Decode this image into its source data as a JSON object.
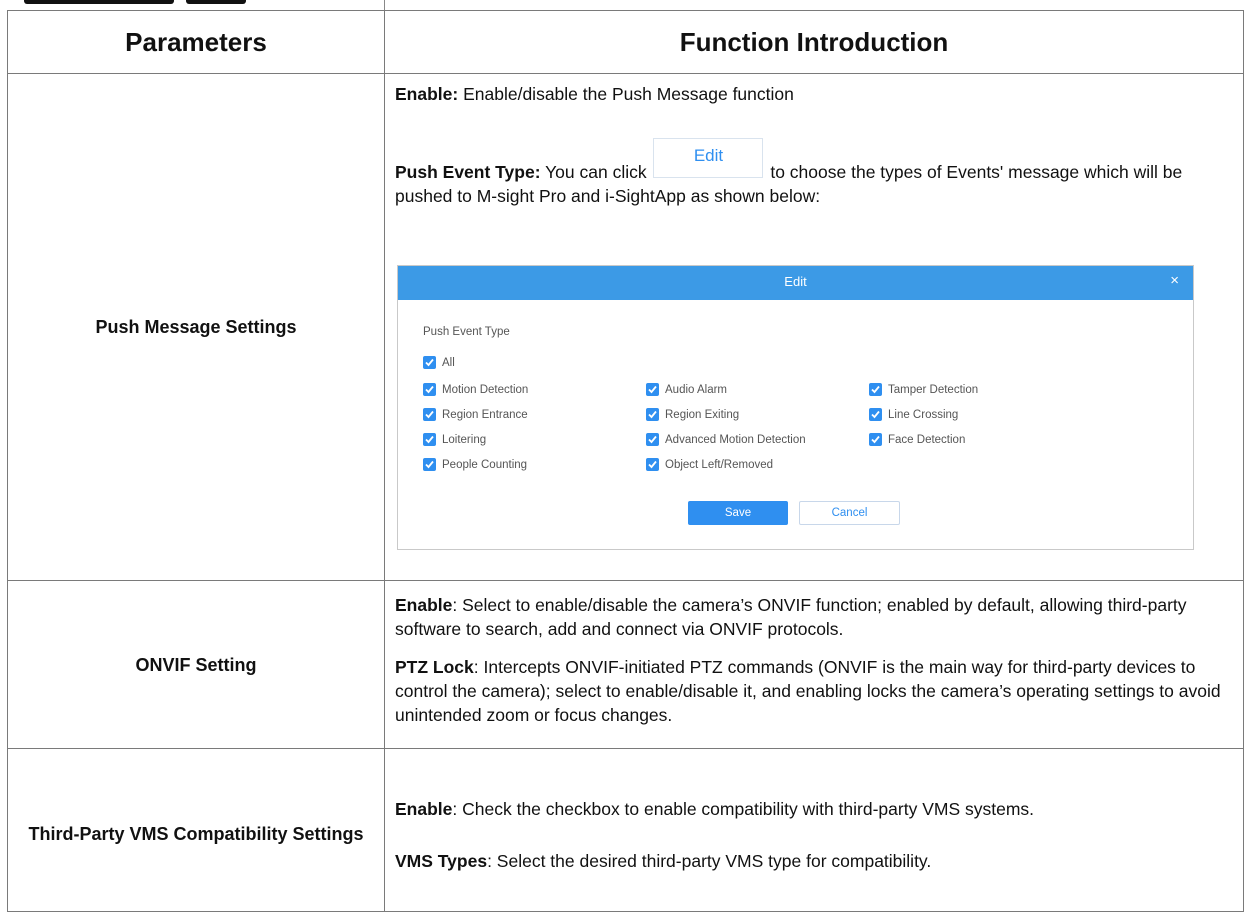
{
  "table": {
    "headers": {
      "parameters": "Parameters",
      "function": "Function Introduction"
    },
    "rows": [
      {
        "param": "Push Message Settings"
      },
      {
        "param": "ONVIF Setting"
      },
      {
        "param": "Third-Party VMS Compatibility Settings"
      }
    ]
  },
  "push": {
    "enable_label": "Enable:",
    "enable_text": "Enable/disable the Push Message function",
    "type_label": "Push Event Type:",
    "type_text_a": "You can click",
    "edit_button": "Edit",
    "type_text_b": "to choose the types of Events' message which will be pushed to M-sight Pro and i-SightApp as shown below:"
  },
  "dialog": {
    "title": "Edit",
    "close": "×",
    "section_label": "Push Event Type",
    "all": "All",
    "options": [
      "Motion Detection",
      "Audio Alarm",
      "Tamper Detection",
      "Region Entrance",
      "Region Exiting",
      "Line Crossing",
      "Loitering",
      "Advanced Motion Detection",
      "Face Detection",
      "People Counting",
      "Object Left/Removed"
    ],
    "save": "Save",
    "cancel": "Cancel",
    "accent": "#2f8ff0",
    "header_color": "#3c9ae6"
  },
  "onvif": {
    "enable_label": "Enable",
    "enable_text": ": Select to enable/disable the camera’s ONVIF function; enabled by default, allowing third-party software to search, add and connect via ONVIF protocols.",
    "ptz_label": "PTZ Lock",
    "ptz_text": ": Intercepts ONVIF-initiated PTZ commands (ONVIF is the main way for third-party devices to control the camera); select to enable/disable it, and enabling locks the camera’s operating settings to avoid unintended zoom or focus changes."
  },
  "vms": {
    "enable_label": "Enable",
    "enable_text": ": Check the checkbox to enable compatibility with third-party VMS systems.",
    "types_label": "VMS Types",
    "types_text": ": Select the desired third-party VMS type for compatibility."
  }
}
